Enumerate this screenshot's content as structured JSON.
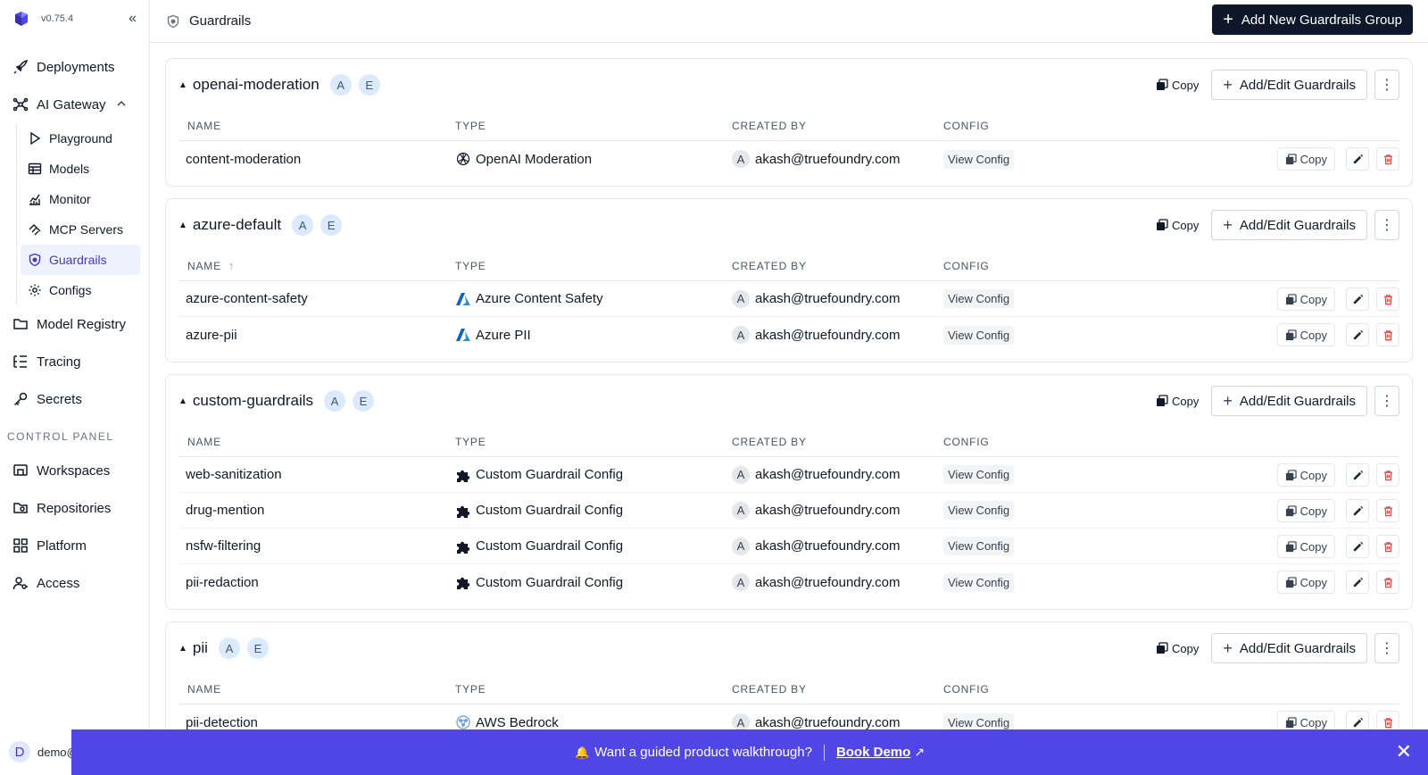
{
  "app": {
    "version": "v0.75.4"
  },
  "sidebar": {
    "items": [
      {
        "label": "Deployments",
        "icon": "rocket-icon"
      },
      {
        "label": "AI Gateway",
        "icon": "gateway-icon"
      },
      {
        "label": "Model Registry",
        "icon": "folder-icon"
      },
      {
        "label": "Tracing",
        "icon": "list-tree-icon"
      },
      {
        "label": "Secrets",
        "icon": "key-icon"
      }
    ],
    "sub_items": [
      {
        "label": "Playground",
        "icon": "play-icon"
      },
      {
        "label": "Models",
        "icon": "table-icon"
      },
      {
        "label": "Monitor",
        "icon": "chart-icon"
      },
      {
        "label": "MCP Servers",
        "icon": "mcp-icon"
      },
      {
        "label": "Guardrails",
        "icon": "shield-icon",
        "active": true
      },
      {
        "label": "Configs",
        "icon": "gear-icon"
      }
    ],
    "control_panel_label": "CONTROL PANEL",
    "control_items": [
      {
        "label": "Workspaces",
        "icon": "workspace-icon"
      },
      {
        "label": "Repositories",
        "icon": "repository-icon"
      },
      {
        "label": "Platform",
        "icon": "grid-icon"
      },
      {
        "label": "Access",
        "icon": "user-key-icon"
      }
    ],
    "user": {
      "initial": "D",
      "name": "demo@"
    }
  },
  "header": {
    "title": "Guardrails",
    "add_group_label": "Add New Guardrails Group"
  },
  "columns": {
    "name": "NAME",
    "type": "TYPE",
    "created_by": "CREATED BY",
    "config": "CONFIG"
  },
  "labels": {
    "copy": "Copy",
    "add_edit": "Add/Edit Guardrails",
    "view_config": "View Config",
    "badge_a": "A",
    "badge_e": "E",
    "avatar_initial": "A"
  },
  "groups": [
    {
      "name": "openai-moderation",
      "rows": [
        {
          "name": "content-moderation",
          "type": "OpenAI Moderation",
          "type_icon": "openai-icon",
          "created_by": "akash@truefoundry.com"
        }
      ]
    },
    {
      "name": "azure-default",
      "sorted": true,
      "rows": [
        {
          "name": "azure-content-safety",
          "type": "Azure Content Safety",
          "type_icon": "azure-icon",
          "created_by": "akash@truefoundry.com"
        },
        {
          "name": "azure-pii",
          "type": "Azure PII",
          "type_icon": "azure-icon",
          "created_by": "akash@truefoundry.com"
        }
      ]
    },
    {
      "name": "custom-guardrails",
      "rows": [
        {
          "name": "web-sanitization",
          "type": "Custom Guardrail Config",
          "type_icon": "puzzle-icon",
          "created_by": "akash@truefoundry.com"
        },
        {
          "name": "drug-mention",
          "type": "Custom Guardrail Config",
          "type_icon": "puzzle-icon",
          "created_by": "akash@truefoundry.com"
        },
        {
          "name": "nsfw-filtering",
          "type": "Custom Guardrail Config",
          "type_icon": "puzzle-icon",
          "created_by": "akash@truefoundry.com"
        },
        {
          "name": "pii-redaction",
          "type": "Custom Guardrail Config",
          "type_icon": "puzzle-icon",
          "created_by": "akash@truefoundry.com"
        }
      ]
    },
    {
      "name": "pii",
      "rows": [
        {
          "name": "pii-detection",
          "type": "AWS Bedrock",
          "type_icon": "aws-bedrock-icon",
          "created_by": "akash@truefoundry.com"
        }
      ]
    }
  ],
  "banner": {
    "text": "Want a guided product walkthrough?",
    "link": "Book Demo"
  },
  "colors": {
    "accent": "#4f46e5",
    "primary_button": "#0f172a",
    "delete": "#ef4444",
    "active_nav": "#4338ca"
  }
}
